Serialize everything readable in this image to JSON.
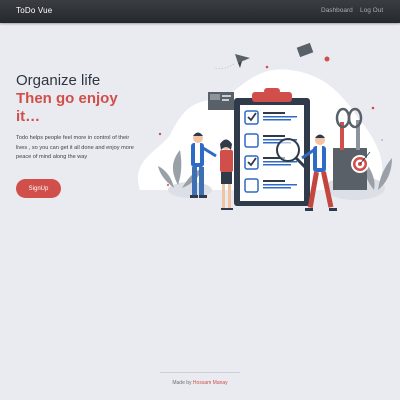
{
  "navbar": {
    "brand": "ToDo Vue",
    "links": [
      {
        "label": "Dashboard"
      },
      {
        "label": "Log Out"
      }
    ]
  },
  "hero": {
    "title": "Organize life",
    "highlight": "Then go enjoy it…",
    "description": "Todo helps people feel more in control of their lives , so you can get it all done and enjoy more peace of mind along the way",
    "signup_label": "SignUp"
  },
  "footer": {
    "prefix": "Made by ",
    "author": "Hossam Manay"
  },
  "colors": {
    "accent": "#d14f4a",
    "navbar": "#2b2e33",
    "background": "#e9ebf0",
    "illustration_blue": "#2f6ac4"
  }
}
